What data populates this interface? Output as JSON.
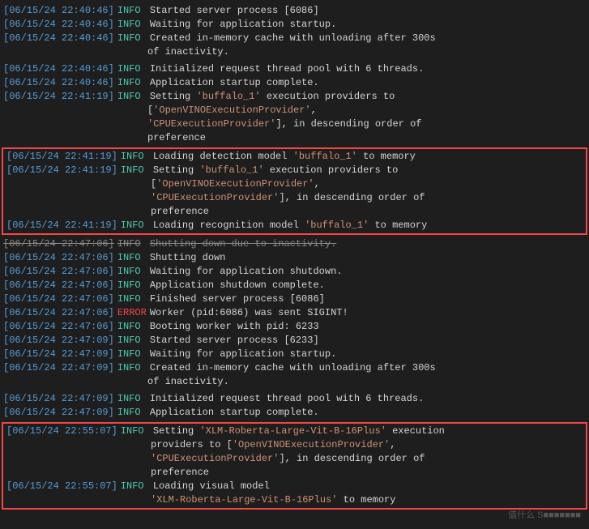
{
  "log": {
    "entries": [
      {
        "ts": "[06/15/24 22:40:46]",
        "level": "INFO",
        "msg": "Started server process [6086]"
      },
      {
        "ts": "[06/15/24 22:40:46]",
        "level": "INFO",
        "msg": "Waiting for application startup."
      },
      {
        "ts": "[06/15/24 22:40:46]",
        "level": "INFO",
        "msg": "Created in-memory cache with unloading after 300s"
      },
      {
        "ts": "",
        "level": "",
        "msg": "of inactivity."
      },
      {
        "ts": "[06/15/24 22:40:46]",
        "level": "INFO",
        "msg": "Initialized request thread pool with 6 threads."
      },
      {
        "ts": "[06/15/24 22:40:46]",
        "level": "INFO",
        "msg": "Application startup complete."
      },
      {
        "ts": "[06/15/24 22:41:19]",
        "level": "INFO",
        "msg_parts": [
          "Setting ",
          "'buffalo_1'",
          " execution providers to"
        ],
        "highlight": true,
        "highlight_idx": 1
      },
      {
        "ts": "",
        "level": "",
        "msg_parts": [
          "['",
          "OpenVINOExecutionProvider",
          "',"
        ],
        "continuation": true
      },
      {
        "ts": "",
        "level": "",
        "msg_parts": [
          "'",
          "CPUExecutionProvider",
          "'], in descending order of"
        ],
        "continuation": true
      },
      {
        "ts": "",
        "level": "",
        "msg": "preference",
        "continuation": true
      }
    ]
  },
  "redbox1": {
    "entries": [
      {
        "ts": "[06/15/24 22:41:19]",
        "level": "INFO",
        "msg_parts": [
          "Loading detection model ",
          "'buffalo_1'",
          " to memory"
        ]
      },
      {
        "ts": "[06/15/24 22:41:19]",
        "level": "INFO",
        "msg_parts": [
          "Setting ",
          "'buffalo_1'",
          " execution providers to"
        ]
      },
      {
        "ts": "",
        "level": "",
        "msg": "['OpenVINOExecutionProvider',",
        "continuation": true
      },
      {
        "ts": "",
        "level": "",
        "msg": "'CPUExecutionProvider'], in descending order of",
        "continuation": true
      },
      {
        "ts": "",
        "level": "",
        "msg": "preference",
        "continuation": true
      },
      {
        "ts": "[06/15/24 22:41:19]",
        "level": "INFO",
        "msg_parts": [
          "Loading recognition model ",
          "'buffalo_1'",
          " to memory"
        ]
      }
    ]
  },
  "middle": {
    "entries": [
      {
        "ts": "[06/15/24 22:47:06]",
        "level": "INFO",
        "msg": "Shutting down due to inactivity.",
        "strikethrough": false
      },
      {
        "ts": "[06/15/24 22:47:06]",
        "level": "INFO",
        "msg": "Shutting down"
      },
      {
        "ts": "[06/15/24 22:47:06]",
        "level": "INFO",
        "msg": "Waiting for application shutdown."
      },
      {
        "ts": "[06/15/24 22:47:06]",
        "level": "INFO",
        "msg": "Application shutdown complete."
      },
      {
        "ts": "[06/15/24 22:47:06]",
        "level": "INFO",
        "msg": "Finished server process [6086]"
      },
      {
        "ts": "[06/15/24 22:47:06]",
        "level": "ERROR",
        "msg": "Worker (pid:6086) was sent SIGINT!"
      },
      {
        "ts": "[06/15/24 22:47:06]",
        "level": "INFO",
        "msg": "Booting worker with pid: 6233"
      },
      {
        "ts": "[06/15/24 22:47:09]",
        "level": "INFO",
        "msg": "Started server process [6233]"
      },
      {
        "ts": "[06/15/24 22:47:09]",
        "level": "INFO",
        "msg": "Waiting for application startup."
      },
      {
        "ts": "[06/15/24 22:47:09]",
        "level": "INFO",
        "msg": "Created in-memory cache with unloading after 300s"
      },
      {
        "ts": "",
        "level": "",
        "msg": "of inactivity.",
        "continuation": true
      },
      {
        "ts": "[06/15/24 22:47:09]",
        "level": "INFO",
        "msg": "Initialized request thread pool with 6 threads."
      },
      {
        "ts": "[06/15/24 22:47:09]",
        "level": "INFO",
        "msg": "Application startup complete."
      }
    ]
  },
  "redbox2": {
    "entries": [
      {
        "ts": "[06/15/24 22:55:07]",
        "level": "INFO",
        "msg_parts": [
          "Setting ",
          "'XLM-Roberta-Large-Vit-B-16Plus'",
          " execution"
        ],
        "extra": " providers to ['OpenVINOExecutionProvider',"
      },
      {
        "ts": "",
        "level": "",
        "msg": "providers to ['OpenVINOExecutionProvider',",
        "continuation": true
      },
      {
        "ts": "",
        "level": "",
        "msg": "'CPUExecutionProvider'], in descending order of",
        "continuation": true
      },
      {
        "ts": "",
        "level": "",
        "msg": "preference",
        "continuation": true
      },
      {
        "ts": "[06/15/24 22:55:07]",
        "level": "INFO",
        "msg": "Loading visual model"
      },
      {
        "ts": "",
        "level": "",
        "msg_parts": [
          "'",
          "XLM-Roberta-Large-Vit-B-16Plus'",
          " to memory"
        ],
        "continuation": true
      }
    ]
  },
  "labels": {
    "booting": "Booting",
    "started": "Started"
  }
}
